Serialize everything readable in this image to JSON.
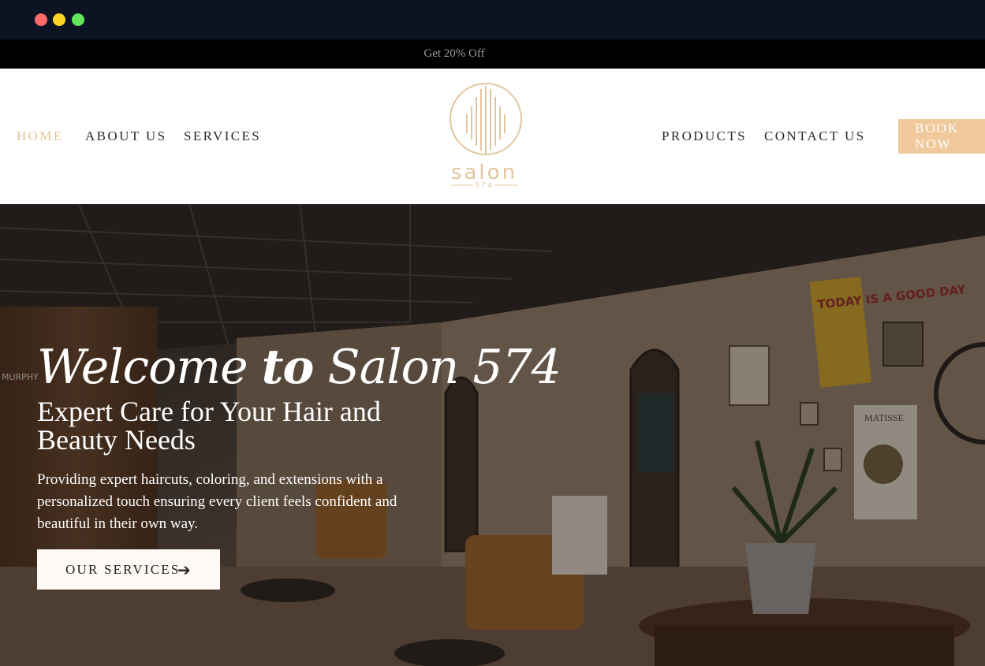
{
  "promo": {
    "text": "Get 20% Off"
  },
  "nav": {
    "home": "HOME",
    "about": "ABOUT US",
    "services": "SERVICES",
    "products": "PRODUCTS",
    "contact": "CONTACT US",
    "book": "BOOK NOW"
  },
  "logo": {
    "name": "salon",
    "number": "574"
  },
  "hero": {
    "title_a": "Welcome ",
    "title_b": "to",
    "title_c": " Salon 574",
    "subtitle": "Expert Care for Your Hair and Beauty Needs",
    "description": "Providing expert haircuts, coloring, and extensions with a personalized touch ensuring every client feels confident and beautiful in their own way.",
    "cta": "OUR SERVICES",
    "bg_text_1": "TODAY IS A GOOD DAY",
    "bg_text_2": "MATISSE",
    "bg_text_3": "MURPHY"
  },
  "colors": {
    "accent": "#f0c99c",
    "active_nav": "#e5c497",
    "chrome": "#0c1424"
  }
}
